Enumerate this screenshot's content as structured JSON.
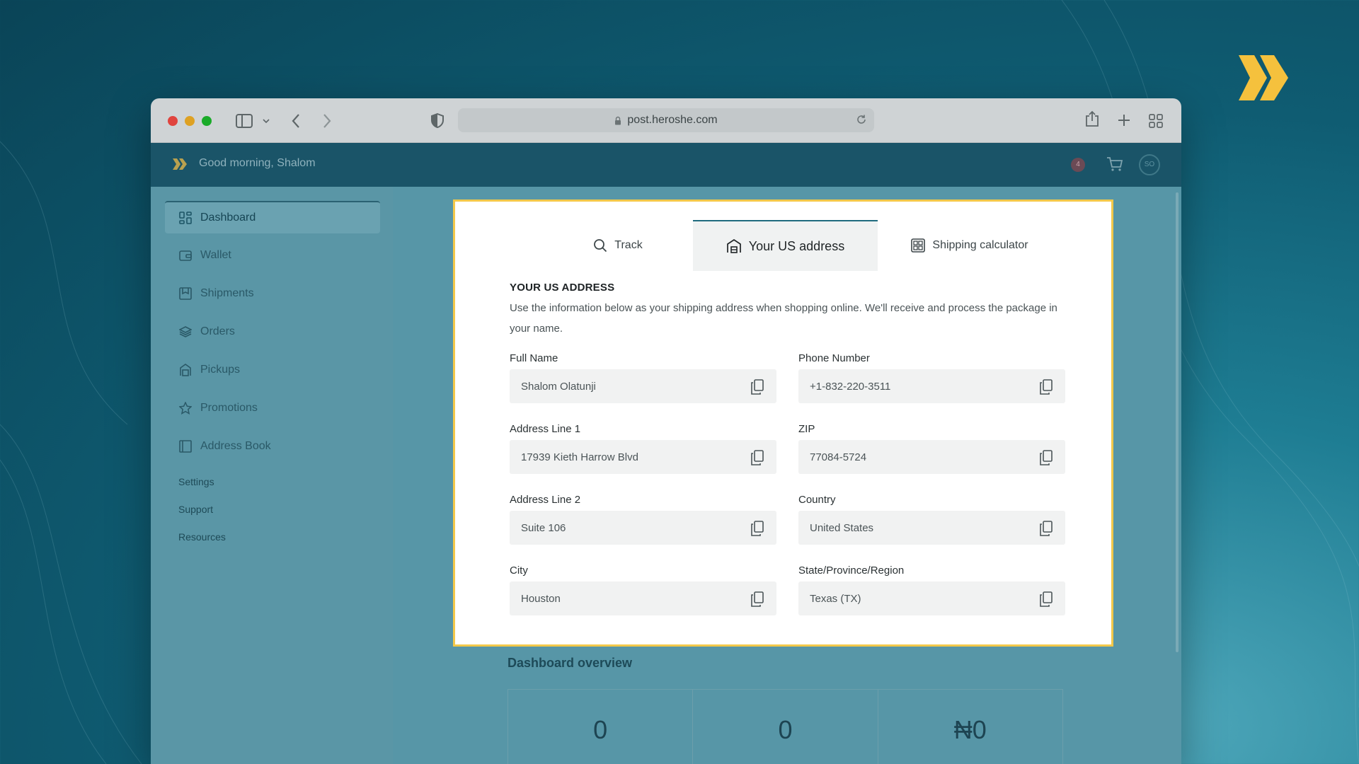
{
  "browser": {
    "url": "post.heroshe.com"
  },
  "header": {
    "greeting": "Good morning, Shalom",
    "notification_count": "4",
    "avatar_initials": "SO"
  },
  "sidebar": {
    "items": [
      {
        "label": "Dashboard",
        "icon": "dashboard-icon",
        "active": true
      },
      {
        "label": "Wallet",
        "icon": "wallet-icon"
      },
      {
        "label": "Shipments",
        "icon": "shipments-icon"
      },
      {
        "label": "Orders",
        "icon": "layers-icon"
      },
      {
        "label": "Pickups",
        "icon": "pickup-icon"
      },
      {
        "label": "Promotions",
        "icon": "star-icon"
      },
      {
        "label": "Address Book",
        "icon": "book-icon"
      }
    ],
    "links": [
      "Settings",
      "Support",
      "Resources"
    ]
  },
  "modal": {
    "tabs": [
      {
        "label": "Track",
        "icon": "search-icon"
      },
      {
        "label": "Your US address",
        "icon": "warehouse-icon",
        "active": true
      },
      {
        "label": "Shipping calculator",
        "icon": "calculator-icon"
      }
    ],
    "title": "YOUR US ADDRESS",
    "description": "Use the information below as your shipping address when shopping online. We'll receive and process the package in your name.",
    "fields": [
      {
        "label": "Full Name",
        "value": "Shalom Olatunji"
      },
      {
        "label": "Phone Number",
        "value": "+1-832-220-3511"
      },
      {
        "label": "Address Line 1",
        "value": "17939 Kieth Harrow Blvd"
      },
      {
        "label": "ZIP",
        "value": "77084-5724"
      },
      {
        "label": "Address Line 2",
        "value": "Suite 106"
      },
      {
        "label": "Country",
        "value": "United States"
      },
      {
        "label": "City",
        "value": "Houston"
      },
      {
        "label": "State/Province/Region",
        "value": "Texas (TX)"
      }
    ]
  },
  "overview": {
    "title": "Dashboard overview",
    "stats": [
      "0",
      "0",
      "₦0"
    ]
  },
  "colors": {
    "highlight_border": "#f3c84a",
    "brand_yellow": "#f5c13d",
    "accent_teal": "#1f6b7e"
  }
}
